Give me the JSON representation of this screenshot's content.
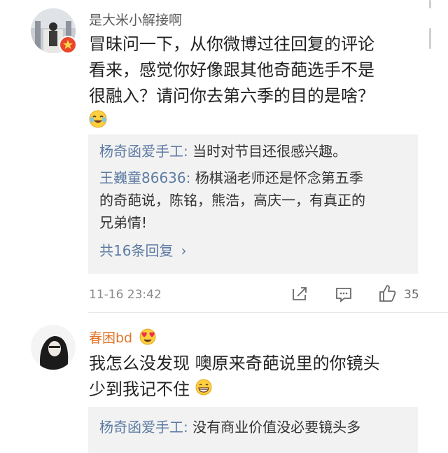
{
  "comments": [
    {
      "username": "是大米小解接啊",
      "content_lines": [
        "冒昧问一下，从你微博过往回复的评论",
        "看来，感觉你好像跟其他奇葩选手不是",
        "很融入？请问你去第六季的目的是啥？"
      ],
      "content_emoji": "laughing-crying-emoji",
      "replies": [
        {
          "name": "杨奇函爱手工:",
          "text": " 当时对节目还很感兴趣。"
        },
        {
          "name": "王巍童86636:",
          "text": " 杨棋涵老师还是怀念第五季",
          "text2": "的奇葩说，陈铭，熊浩，高庆一，有真正的",
          "text3": "兄弟情!"
        }
      ],
      "more_replies": "共16条回复",
      "more_chevron": "›",
      "timestamp": "11-16 23:42",
      "like_count": "35"
    },
    {
      "username": "春困bd",
      "badge_emoji": "heart-eyes-emoji",
      "content_lines": [
        "我怎么没发现 噢原来奇葩说里的你镜头",
        "少到我记不住"
      ],
      "content_emoji": "grinning-emoji",
      "replies": [
        {
          "name": "杨奇函爱手工:",
          "text": " 没有商业价值没必要镜头多"
        }
      ]
    }
  ],
  "colors": {
    "link": "#5d7ba3",
    "reply_bg": "#f2f2f2",
    "meta": "#8a8a8a"
  }
}
